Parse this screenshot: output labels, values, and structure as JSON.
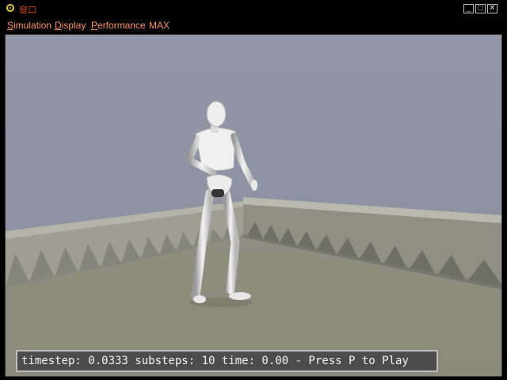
{
  "window": {
    "title": "窗口",
    "controls": [
      "minimize",
      "maximize",
      "close"
    ]
  },
  "menu": {
    "items": [
      {
        "label": "Simulation",
        "underline": "S"
      },
      {
        "label": "Display",
        "underline": "D"
      },
      {
        "label": "Performance",
        "underline": "P"
      },
      {
        "label": "MAX",
        "underline": ""
      }
    ]
  },
  "status": {
    "text": "timestep: 0.0333 substeps: 10 time: 0.00 - Press P to Play"
  },
  "colors": {
    "sky": "#8e93a4",
    "floor": "#8e8e7e",
    "wall": "#a4a596",
    "figure": "#e8e8e8",
    "menu_text": "#ff9060"
  }
}
